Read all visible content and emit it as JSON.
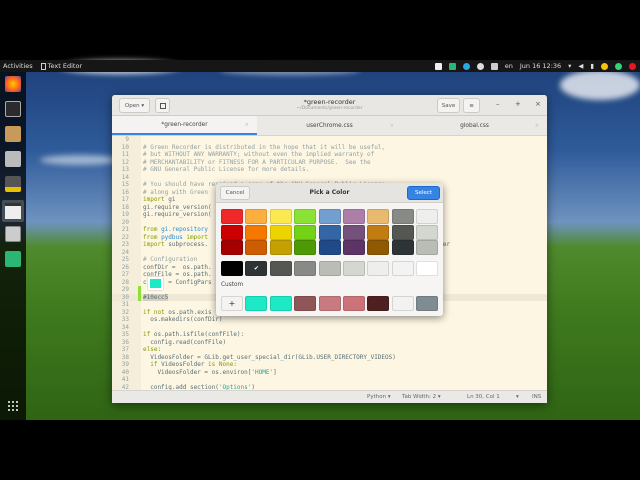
{
  "topbar": {
    "activities": "Activities",
    "app": "Text Editor",
    "lang": "en",
    "clock": "Jun 16 12:36"
  },
  "window": {
    "open_label": "Open ▾",
    "title": "*green-recorder",
    "subtitle": "~/Documents/green-recorder",
    "save_label": "Save",
    "minimize": "–",
    "maximize": "+",
    "close": "×"
  },
  "tabs": [
    {
      "label": "*green-recorder"
    },
    {
      "label": "userChrome.css"
    },
    {
      "label": "global.css"
    }
  ],
  "editor": {
    "lines": [
      {
        "n": "9",
        "s": []
      },
      {
        "n": "10",
        "s": [
          {
            "t": "# Green Recorder is distributed in the hope that it will be useful,",
            "k": "comment"
          }
        ]
      },
      {
        "n": "11",
        "s": [
          {
            "t": "# but WITHOUT ANY WARRANTY; without even the implied warranty of",
            "k": "comment"
          }
        ]
      },
      {
        "n": "12",
        "s": [
          {
            "t": "# MERCHANTABILITY or FITNESS FOR A PARTICULAR PURPOSE.  See the",
            "k": "comment"
          }
        ]
      },
      {
        "n": "13",
        "s": [
          {
            "t": "# GNU General Public License for more details.",
            "k": "comment"
          }
        ]
      },
      {
        "n": "14",
        "s": []
      },
      {
        "n": "15",
        "s": [
          {
            "t": "# You should have received a copy of the GNU General Public License",
            "k": "comment"
          }
        ]
      },
      {
        "n": "16",
        "s": [
          {
            "t": "# along with Green ",
            "k": "comment"
          }
        ]
      },
      {
        "n": "17",
        "s": [
          {
            "t": "import",
            "k": "keyword"
          },
          {
            "t": " gi",
            "k": "plain"
          }
        ]
      },
      {
        "n": "18",
        "s": [
          {
            "t": "gi.require_version(",
            "k": "plain"
          }
        ]
      },
      {
        "n": "19",
        "s": [
          {
            "t": "gi.require_version(",
            "k": "plain"
          }
        ]
      },
      {
        "n": "20",
        "s": []
      },
      {
        "n": "21",
        "s": [
          {
            "t": "from",
            "k": "keyword"
          },
          {
            "t": " gi.repository",
            "k": "module"
          }
        ]
      },
      {
        "n": "22",
        "s": [
          {
            "t": "from",
            "k": "keyword"
          },
          {
            "t": " pydbus",
            "k": "module"
          },
          {
            "t": " import",
            "k": "keyword"
          }
        ]
      },
      {
        "n": "23",
        "s": [
          {
            "t": "import",
            "k": "keyword"
          },
          {
            "t": " subprocess.                                                          figParser",
            "k": "plain"
          }
        ]
      },
      {
        "n": "24",
        "s": []
      },
      {
        "n": "25",
        "s": [
          {
            "t": "# Configuration",
            "k": "comment"
          }
        ]
      },
      {
        "n": "26",
        "s": [
          {
            "t": "confDir =  os.path.",
            "k": "plain"
          }
        ]
      },
      {
        "n": "27",
        "s": [
          {
            "t": "confFile = os.path.",
            "k": "plain"
          }
        ]
      },
      {
        "n": "28",
        "s": [
          {
            "t": "c      = ConfigPars",
            "k": "plain"
          }
        ]
      },
      {
        "n": "29",
        "s": []
      },
      {
        "n": "30",
        "s": [
          {
            "t": "#10ecc5",
            "k": "sel"
          }
        ],
        "current": true
      },
      {
        "n": "31",
        "s": []
      },
      {
        "n": "32",
        "s": [
          {
            "t": "if not",
            "k": "keyword"
          },
          {
            "t": " os.path.exis",
            "k": "plain"
          }
        ]
      },
      {
        "n": "33",
        "s": [
          {
            "t": "  os.makedirs(confDir)",
            "k": "plain"
          }
        ]
      },
      {
        "n": "34",
        "s": []
      },
      {
        "n": "35",
        "s": [
          {
            "t": "if",
            "k": "keyword"
          },
          {
            "t": " os.path.isfile(confFile):",
            "k": "plain"
          }
        ]
      },
      {
        "n": "36",
        "s": [
          {
            "t": "  config.read(confFile)",
            "k": "plain"
          }
        ]
      },
      {
        "n": "37",
        "s": [
          {
            "t": "else",
            "k": "keyword"
          },
          {
            "t": ":",
            "k": "plain"
          }
        ]
      },
      {
        "n": "38",
        "s": [
          {
            "t": "  VideosFolder = GLib.get_user_special_dir(GLib.USER_DIRECTORY_VIDEOS)",
            "k": "plain"
          }
        ]
      },
      {
        "n": "39",
        "s": [
          {
            "t": "  if",
            "k": "keyword"
          },
          {
            "t": " VideosFolder ",
            "k": "plain"
          },
          {
            "t": "is None",
            "k": "keyword"
          },
          {
            "t": ":",
            "k": "plain"
          }
        ]
      },
      {
        "n": "40",
        "s": [
          {
            "t": "    VideosFolder = os.environ[",
            "k": "plain"
          },
          {
            "t": "'HOME'",
            "k": "string"
          },
          {
            "t": "]",
            "k": "plain"
          }
        ]
      },
      {
        "n": "41",
        "s": []
      },
      {
        "n": "42",
        "s": [
          {
            "t": "  config.add_section(",
            "k": "plain"
          },
          {
            "t": "'Options'",
            "k": "string"
          },
          {
            "t": ")",
            "k": "plain"
          }
        ]
      },
      {
        "n": "43",
        "s": []
      }
    ]
  },
  "status": {
    "language": "Python ▾",
    "tab_width": "Tab Width: 2 ▾",
    "position": "Ln 30, Col 1",
    "dropdown": "▾",
    "mode": "INS"
  },
  "dialog": {
    "cancel": "Cancel",
    "title": "Pick a Color",
    "select": "Select",
    "custom_label": "Custom",
    "add": "+",
    "palette": [
      [
        "#ef2929",
        "#fcaf3e",
        "#fce94f",
        "#8ae234",
        "#729fcf",
        "#ad7fa8",
        "#e9b96e",
        "#888a85",
        "#eeeeec"
      ],
      [
        "#cc0000",
        "#f57900",
        "#edd400",
        "#73d216",
        "#3465a4",
        "#75507b",
        "#c17d11",
        "#555753",
        "#d3d7cf"
      ],
      [
        "#a40000",
        "#ce5c00",
        "#c4a000",
        "#4e9a06",
        "#204a87",
        "#5c3566",
        "#8f5902",
        "#2e3436",
        "#babdb6"
      ]
    ],
    "grays": [
      "#000000",
      "#2e3436",
      "#555753",
      "#888a85",
      "#babdb6",
      "#d3d7cf",
      "#eeeeec",
      "#f3f3f3",
      "#ffffff"
    ],
    "selected_gray": 1,
    "custom": [
      "#1de9c5",
      "#1de9c5",
      "#8f5658",
      "#c97a7e",
      "#cc7379",
      "#4f2021",
      "#f2f2f2",
      "#7f8c92"
    ]
  },
  "swatch_color": "#1de9c5"
}
